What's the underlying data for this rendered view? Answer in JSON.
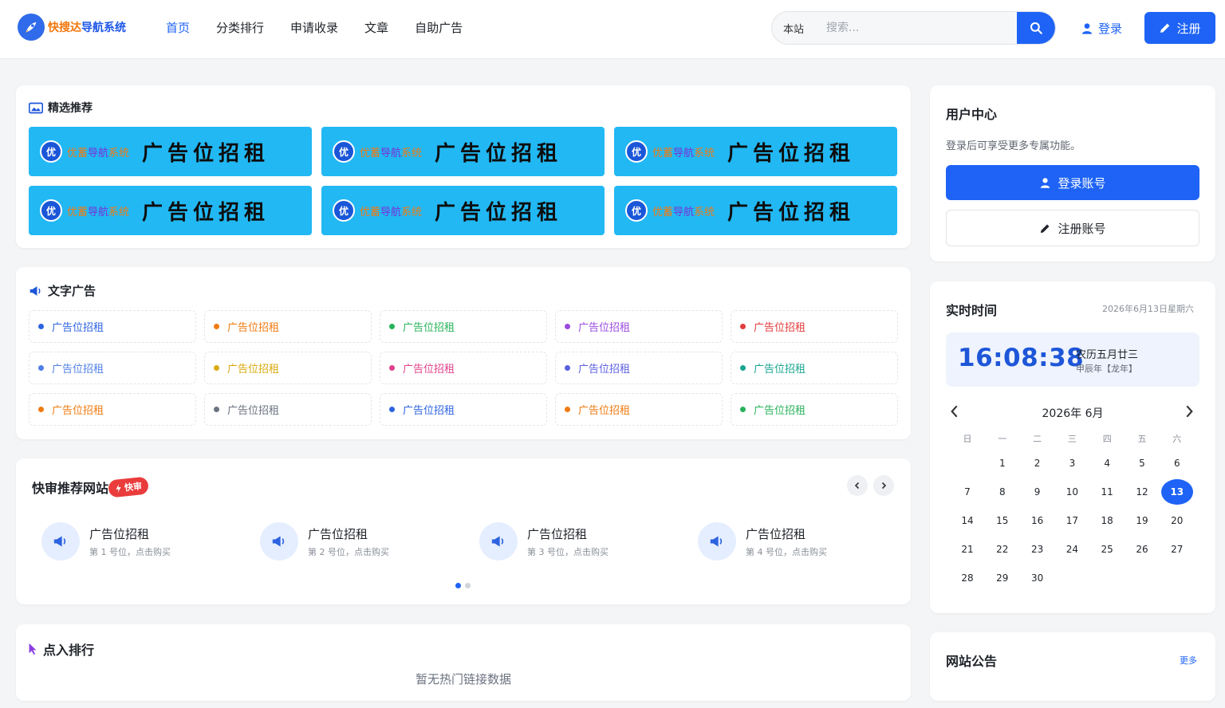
{
  "brand": {
    "name_part1": "快搜达",
    "name_part2": "导航系统"
  },
  "nav": [
    "首页",
    "分类排行",
    "申请收录",
    "文章",
    "自助广告"
  ],
  "search": {
    "scope": "本站",
    "placeholder": "搜索..."
  },
  "header_actions": {
    "login": "登录",
    "register": "注册"
  },
  "featured": {
    "title": "精选推荐",
    "banners": [
      {
        "badge": "优",
        "brand": "优蓄导航系统",
        "text": "广告位招租"
      },
      {
        "badge": "优",
        "brand": "优蓄导航系统",
        "text": "广告位招租"
      },
      {
        "badge": "优",
        "brand": "优蓄导航系统",
        "text": "广告位招租"
      },
      {
        "badge": "优",
        "brand": "优蓄导航系统",
        "text": "广告位招租"
      },
      {
        "badge": "优",
        "brand": "优蓄导航系统",
        "text": "广告位招租"
      },
      {
        "badge": "优",
        "brand": "优蓄导航系统",
        "text": "广告位招租"
      }
    ]
  },
  "text_ads": {
    "title": "文字广告",
    "items": [
      {
        "label": "广告位招租",
        "color": "#2d63e0"
      },
      {
        "label": "广告位招租",
        "color": "#f07a10"
      },
      {
        "label": "广告位招租",
        "color": "#27b35a"
      },
      {
        "label": "广告位招租",
        "color": "#9b4ae0"
      },
      {
        "label": "广告位招租",
        "color": "#e23b3b"
      },
      {
        "label": "广告位招租",
        "color": "#4f7fe6"
      },
      {
        "label": "广告位招租",
        "color": "#d9a90d"
      },
      {
        "label": "广告位招租",
        "color": "#e0408a"
      },
      {
        "label": "广告位招租",
        "color": "#5b5fe0"
      },
      {
        "label": "广告位招租",
        "color": "#17a590"
      },
      {
        "label": "广告位招租",
        "color": "#f07a10"
      },
      {
        "label": "广告位招租",
        "color": "#6b7280"
      },
      {
        "label": "广告位招租",
        "color": "#2d63e0"
      },
      {
        "label": "广告位招租",
        "color": "#f07a10"
      },
      {
        "label": "广告位招租",
        "color": "#27b35a"
      }
    ]
  },
  "quick_review": {
    "title": "快审推荐网站",
    "tag": "快审",
    "items": [
      {
        "title": "广告位招租",
        "subtitle": "第 1 号位，点击购买"
      },
      {
        "title": "广告位招租",
        "subtitle": "第 2 号位，点击购买"
      },
      {
        "title": "广告位招租",
        "subtitle": "第 3 号位，点击购买"
      },
      {
        "title": "广告位招租",
        "subtitle": "第 4 号位，点击购买"
      }
    ]
  },
  "ranking": {
    "title": "点入排行",
    "empty": "暂无热门链接数据"
  },
  "user_center": {
    "title": "用户中心",
    "desc": "登录后可享受更多专属功能。",
    "login_button": "登录账号",
    "register_button": "注册账号"
  },
  "clock": {
    "title": "实时时间",
    "date": "2026年6月13日星期六",
    "time": "16:08:38",
    "lunar": "农历五月廿三",
    "ganzhi": "甲辰年【龙年】"
  },
  "calendar": {
    "month_label": "2026年 6月",
    "weekdays": [
      "日",
      "一",
      "二",
      "三",
      "四",
      "五",
      "六"
    ],
    "first_weekday": 1,
    "days": 30,
    "today": 13
  },
  "notice": {
    "title": "网站公告",
    "more": "更多"
  },
  "colors": {
    "primary": "#1e63f5",
    "banner": "#22b8f3"
  }
}
